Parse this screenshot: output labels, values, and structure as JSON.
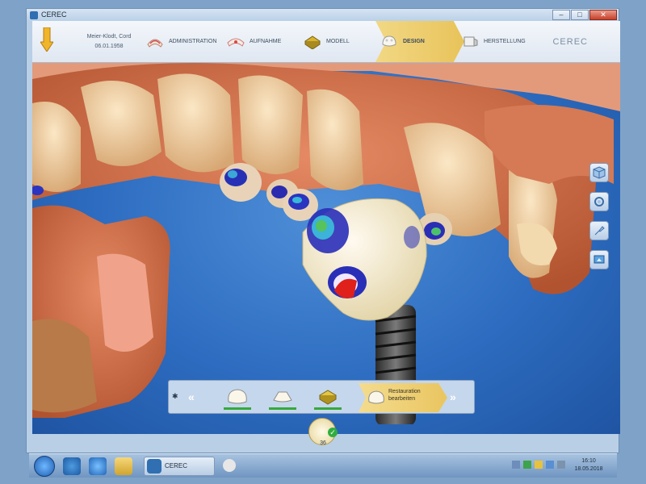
{
  "window": {
    "title": "CEREC",
    "minimize_glyph": "–",
    "maximize_glyph": "□",
    "close_glyph": "✕"
  },
  "patient": {
    "name": "Meier-Klodt, Cord",
    "birthdate": "06.01.1958"
  },
  "phases": [
    {
      "label": "ADMINISTRATION",
      "icon": "administration-icon",
      "state": "done"
    },
    {
      "label": "AUFNAHME",
      "icon": "acquisition-icon",
      "state": "done"
    },
    {
      "label": "MODELL",
      "icon": "model-icon",
      "state": "done"
    },
    {
      "label": "DESIGN",
      "icon": "design-icon",
      "state": "active"
    },
    {
      "label": "HERSTELLUNG",
      "icon": "manufacture-icon",
      "state": "pending"
    }
  ],
  "brand": "CEREC",
  "steps": {
    "prev_glyph": "«",
    "next_glyph": "»",
    "active_label": "Restauration bearbeiten",
    "completed_color": "#36a93a"
  },
  "tooth": {
    "number": "36",
    "check_glyph": "✓"
  },
  "side_tools": [
    "view-cube-icon",
    "rotate-icon",
    "tool-icon",
    "screen-icon"
  ],
  "taskbar": {
    "active_task": "CEREC",
    "time": "16:10",
    "date": "18.05.2018"
  },
  "colors": {
    "accent_active": "#e9c560",
    "viewport_bg": "#2d6cc0",
    "contact_red": "#e0201a",
    "contact_blue": "#1b2fb8"
  }
}
